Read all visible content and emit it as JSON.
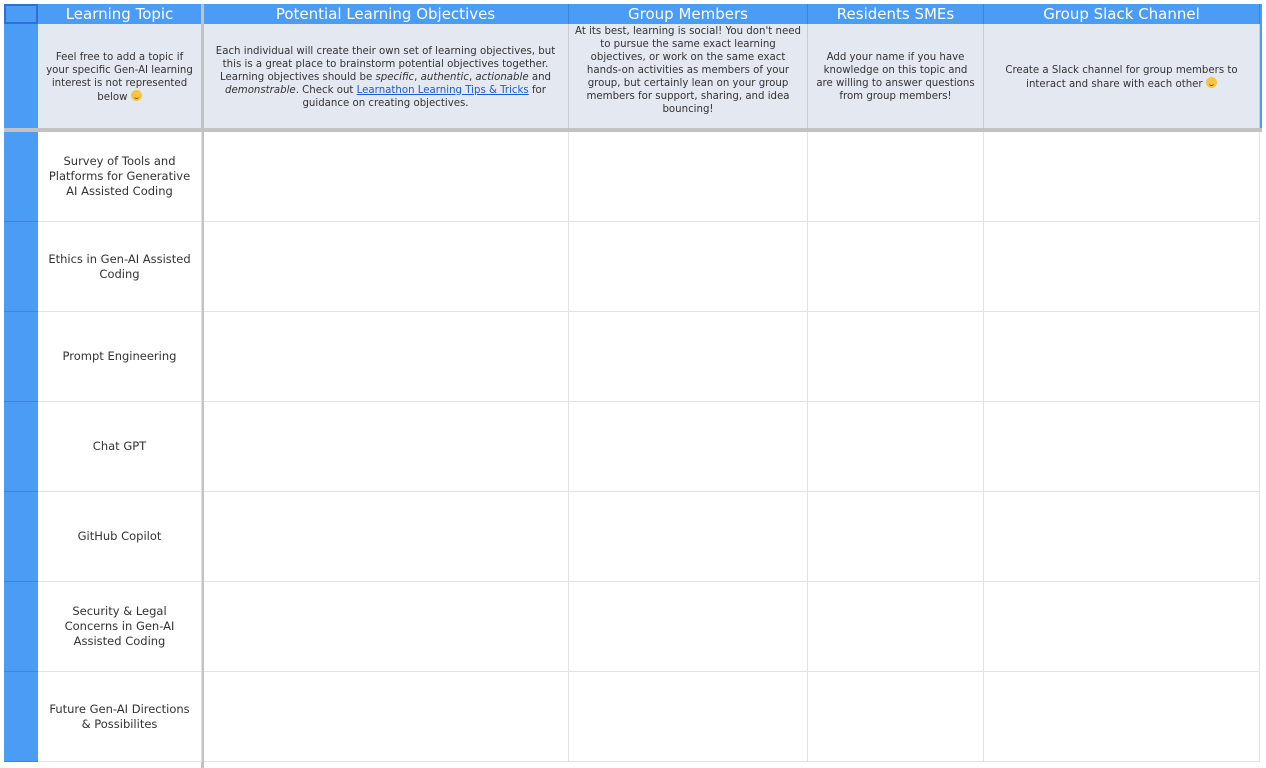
{
  "columns": [
    {
      "header": "Learning Topic",
      "description": "Feel free to add a topic if your specific Gen-AI learning interest is not represented below"
    },
    {
      "header": "Potential Learning Objectives",
      "description_parts": {
        "p1": "Each individual will create their own set of learning objectives, but this is a great place to brainstorm potential objectives together. Learning objectives should be ",
        "i1": "specific",
        "s1": ", ",
        "i2": "authentic",
        "s2": ", ",
        "i3": "actionable",
        "s3": " and ",
        "i4": "demonstrable",
        "s4": ". Check out ",
        "link": "Learnathon Learning Tips & Tricks",
        "p2": " for guidance on creating objectives."
      }
    },
    {
      "header": "Group Members",
      "description": "At its best, learning is social! You don't need to pursue the same exact learning objectives, or work on the same exact hands-on activities as members of your group, but certainly lean on your group members for support, sharing, and idea bouncing!"
    },
    {
      "header": "Residents SMEs",
      "description": "Add your name if you have knowledge on this topic and are willing to answer questions from group members!"
    },
    {
      "header": "Group Slack Channel",
      "description": "Create a Slack channel for group members to interact and share with each other"
    }
  ],
  "topics": [
    "Survey of Tools and Platforms for Generative AI Assisted Coding",
    "Ethics in Gen-AI Assisted Coding",
    "Prompt Engineering",
    "Chat GPT",
    "GitHub Copilot",
    "Security & Legal Concerns in Gen-AI Assisted Coding",
    "Future Gen-AI Directions & Possibilites"
  ],
  "icons": {
    "emoji": "smiling-face-emoji-icon"
  },
  "colors": {
    "header_bg": "#4a9cf5",
    "description_bg": "#e4e8f1",
    "link": "#1a5bd6"
  }
}
